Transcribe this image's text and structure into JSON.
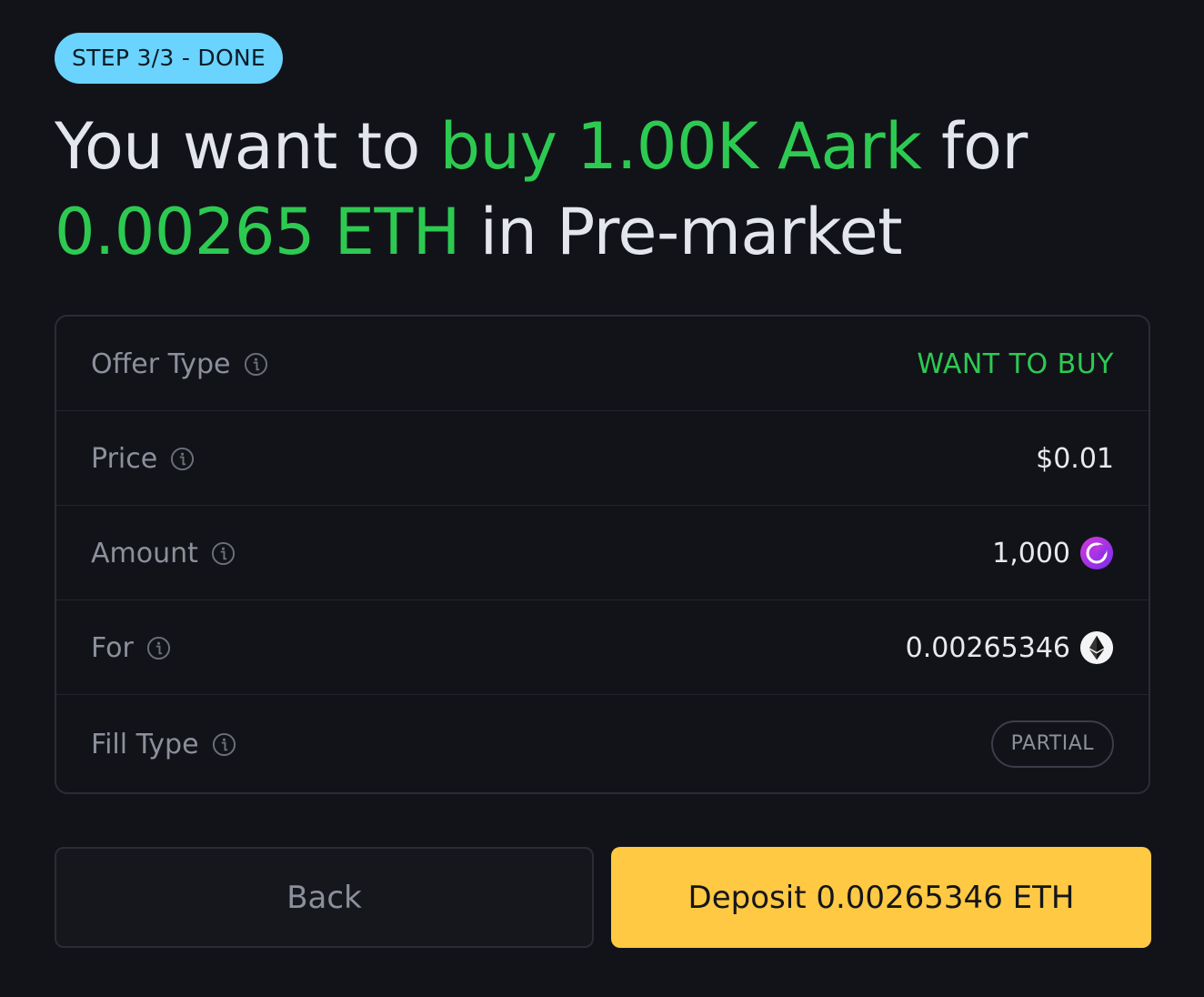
{
  "step_pill": "STEP 3/3 - DONE",
  "headline": {
    "part1": "You want to ",
    "action": "buy 1.00K Aark",
    "part2": " for",
    "price": "0.00265 ETH",
    "part3": " in Pre-market"
  },
  "rows": [
    {
      "label": "Offer Type",
      "value": "WANT TO BUY"
    },
    {
      "label": "Price",
      "value": "$0.01"
    },
    {
      "label": "Amount",
      "value": "1,000",
      "icon": "aark-token-icon"
    },
    {
      "label": "For",
      "value": "0.00265346",
      "icon": "eth-token-icon"
    },
    {
      "label": "Fill Type",
      "value": "PARTIAL"
    }
  ],
  "buttons": {
    "back": "Back",
    "deposit": "Deposit 0.00265346 ETH"
  },
  "colors": {
    "background": "#121318",
    "accent_green": "#2dca52",
    "step_pill": "#6ad4ff",
    "deposit_button": "#ffc944"
  }
}
